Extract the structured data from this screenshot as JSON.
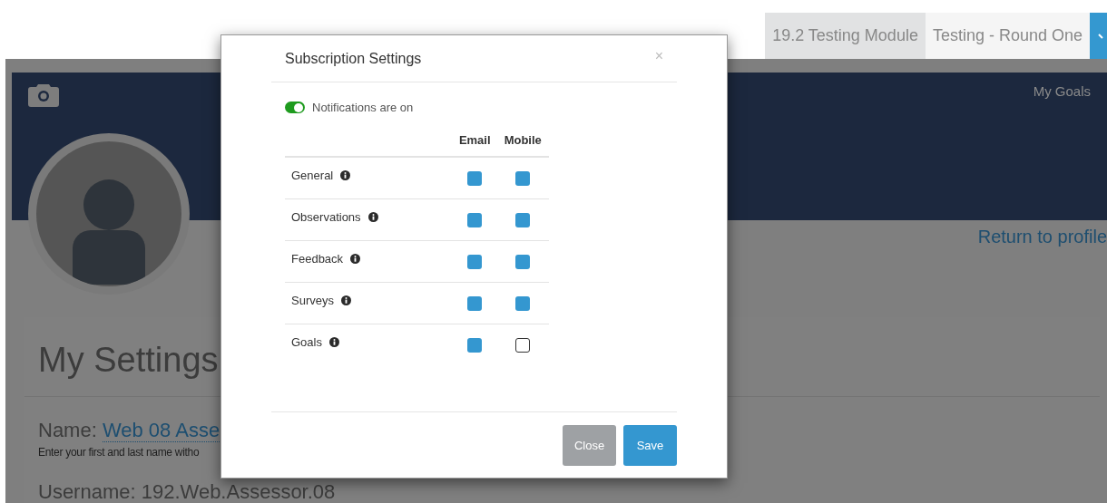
{
  "module_tabs": [
    {
      "label": "19.2 Testing Module",
      "selected": true
    },
    {
      "label": "Testing - Round One",
      "selected": false
    }
  ],
  "banner": {
    "link": "My Goals"
  },
  "return_link": "Return to profile",
  "settings": {
    "title": "My Settings",
    "name_label": "Name:",
    "name_value": "Web 08 Asse",
    "name_hint": "Enter your first and last name witho",
    "username": "Username: 192.Web.Assessor.08"
  },
  "modal": {
    "title": "Subscription Settings",
    "close": "×",
    "notifications": {
      "on": true,
      "label": "Notifications are on"
    },
    "columns": [
      "Email",
      "Mobile"
    ],
    "rows": [
      {
        "label": "General",
        "email": true,
        "mobile": true
      },
      {
        "label": "Observations",
        "email": true,
        "mobile": true
      },
      {
        "label": "Feedback",
        "email": true,
        "mobile": true
      },
      {
        "label": "Surveys",
        "email": true,
        "mobile": true
      },
      {
        "label": "Goals",
        "email": true,
        "mobile": false
      }
    ],
    "buttons": [
      {
        "label": "Close",
        "kind": "secondary"
      },
      {
        "label": "Save",
        "kind": "primary"
      }
    ]
  }
}
